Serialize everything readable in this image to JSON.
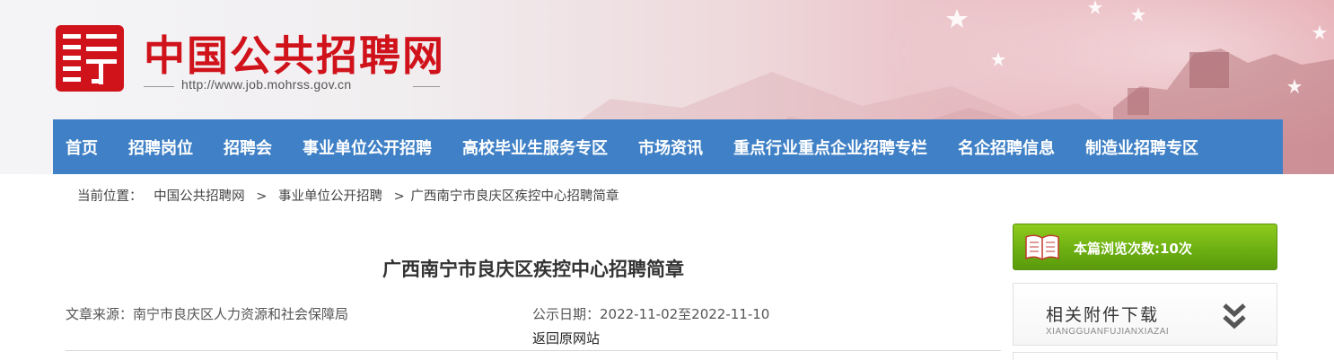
{
  "header": {
    "site_title": "中国公共招聘网",
    "site_url": "http://www.job.mohrss.gov.cn",
    "logo_icon": "ping-character-logo",
    "brand_color": "#d0121b"
  },
  "nav": {
    "color": "#3f80c6",
    "items": [
      {
        "label": "首页"
      },
      {
        "label": "招聘岗位"
      },
      {
        "label": "招聘会"
      },
      {
        "label": "事业单位公开招聘"
      },
      {
        "label": "高校毕业生服务专区"
      },
      {
        "label": "市场资讯"
      },
      {
        "label": "重点行业重点企业招聘专栏"
      },
      {
        "label": "名企招聘信息"
      },
      {
        "label": "制造业招聘专区"
      }
    ]
  },
  "breadcrumb": {
    "prefix": "当前位置：",
    "items": [
      "中国公共招聘网",
      "事业单位公开招聘",
      "广西南宁市良庆区疾控中心招聘简章"
    ],
    "separator": ">"
  },
  "article": {
    "title": "广西南宁市良庆区疾控中心招聘简章",
    "source": "文章来源：南宁市良庆区人力资源和社会保障局",
    "date": "公示日期：2022-11-02至2022-11-10",
    "back_link": "返回原网站"
  },
  "sidebar": {
    "views_label": "本篇浏览次数:10次",
    "views_icon": "open-book-icon",
    "views_color": "#6db012",
    "attachments_title": "相关附件下载",
    "attachments_subtitle": "XIANGGUANFUJIANXIAZAI",
    "attachments_icon": "double-chevron-down-icon"
  }
}
